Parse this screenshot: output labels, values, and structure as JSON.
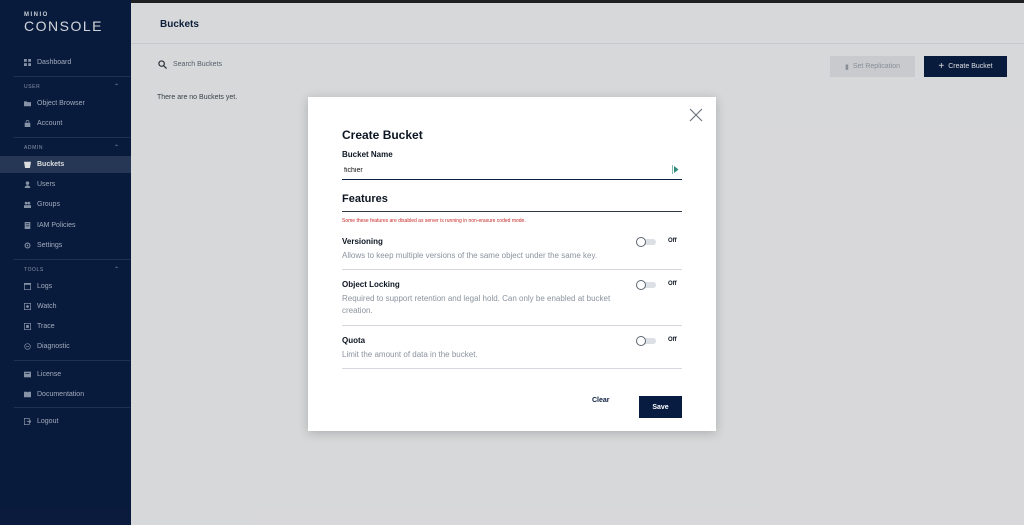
{
  "brand": {
    "small": "MINIO",
    "big": "CONSOLE"
  },
  "sidebar": {
    "items": [
      {
        "label": "Dashboard",
        "icon": "dashboard-icon"
      },
      {
        "label": "Object Browser",
        "icon": "folder-icon"
      },
      {
        "label": "Account",
        "icon": "lock-icon"
      },
      {
        "label": "Buckets",
        "icon": "bucket-icon",
        "active": true
      },
      {
        "label": "Users",
        "icon": "user-icon"
      },
      {
        "label": "Groups",
        "icon": "group-icon"
      },
      {
        "label": "IAM Policies",
        "icon": "policy-icon"
      },
      {
        "label": "Settings",
        "icon": "gear-icon"
      },
      {
        "label": "Logs",
        "icon": "logs-icon"
      },
      {
        "label": "Watch",
        "icon": "watch-icon"
      },
      {
        "label": "Trace",
        "icon": "trace-icon"
      },
      {
        "label": "Diagnostic",
        "icon": "diagnostic-icon"
      },
      {
        "label": "License",
        "icon": "license-icon"
      },
      {
        "label": "Documentation",
        "icon": "documentation-icon"
      },
      {
        "label": "Logout",
        "icon": "logout-icon"
      }
    ],
    "sections": {
      "user": "USER",
      "admin": "ADMIN",
      "tools": "TOOLS"
    }
  },
  "main": {
    "title": "Buckets",
    "search_label": "Search Buckets",
    "set_replication": "Set Replication",
    "create_bucket": "Create Bucket",
    "empty": "There are no Buckets yet."
  },
  "modal": {
    "title": "Create Bucket",
    "bucket_name_label": "Bucket Name",
    "bucket_name_value": "fichier",
    "features_title": "Features",
    "warning": "Some these features are disabled as server is running in non-erasure coded mode.",
    "options": [
      {
        "title": "Versioning",
        "desc": "Allows to keep multiple versions of the same object under the same key.",
        "state": "Off"
      },
      {
        "title": "Object Locking",
        "desc": "Required to support retention and legal hold. Can only be enabled at bucket creation.",
        "state": "Off"
      },
      {
        "title": "Quota",
        "desc": "Limit the amount of data in the bucket.",
        "state": "Off"
      }
    ],
    "clear": "Clear",
    "save": "Save"
  },
  "colors": {
    "navy": "#081c42",
    "warning": "#c62828"
  }
}
